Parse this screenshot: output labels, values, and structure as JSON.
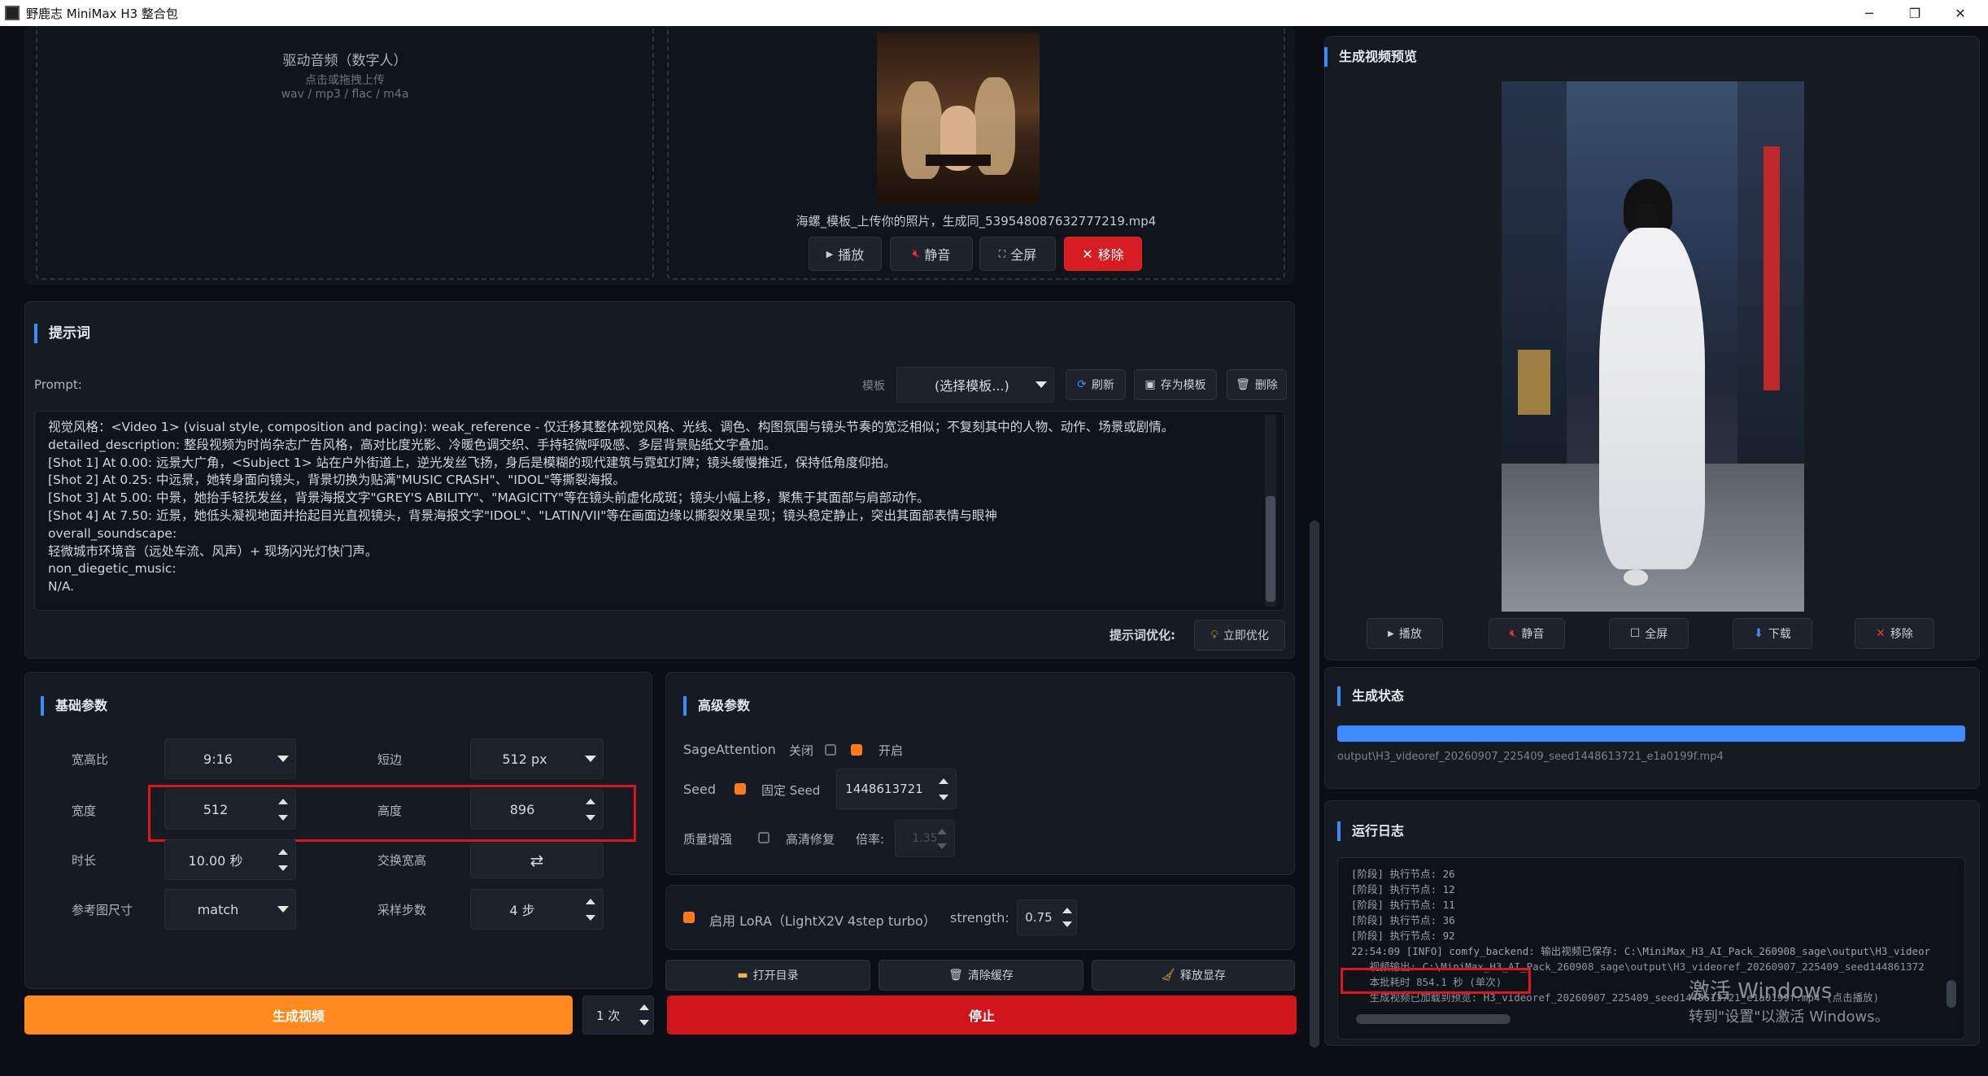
{
  "window": {
    "title": "野鹿志 MiniMax H3 整合包",
    "min": "─",
    "max": "❐",
    "close": "✕"
  },
  "upload": {
    "audio_title": "驱动音频（数字人）",
    "audio_hint": "点击或拖拽上传",
    "audio_formats": "wav / mp3 / flac / m4a",
    "video_filename": "海螺_模板_上传你的照片，生成同_539548087632777219.mp4",
    "play": "播放",
    "mute": "静音",
    "fullscreen": "全屏",
    "remove": "移除"
  },
  "prompt": {
    "section_title": "提示词",
    "label": "Prompt:",
    "template_label": "模板",
    "template_select": "(选择模板...)",
    "refresh": "刷新",
    "save_template": "存为模板",
    "delete": "删除",
    "lines": [
      "视觉风格：<Video 1> (visual style, composition and pacing): weak_reference - 仅迁移其整体视觉风格、光线、调色、构图氛围与镜头节奏的宽泛相似；不复刻其中的人物、动作、场景或剧情。",
      "detailed_description: 整段视频为时尚杂志广告风格，高对比度光影、冷暖色调交织、手持轻微呼吸感、多层背景贴纸文字叠加。",
      "[Shot 1] At 0.00: 远景大广角，<Subject 1> 站在户外街道上，逆光发丝飞扬，身后是模糊的现代建筑与霓虹灯牌；镜头缓慢推近，保持低角度仰拍。",
      "[Shot 2] At 0.25: 中远景，她转身面向镜头，背景切换为贴满\"MUSIC CRASH\"、\"IDOL\"等撕裂海报。",
      "[Shot 3] At 5.00: 中景，她抬手轻抚发丝，背景海报文字\"GREY'S ABILITY\"、\"MAGICITY\"等在镜头前虚化成斑；镜头小幅上移，聚焦于其面部与肩部动作。",
      "[Shot 4] At 7.50: 近景，她低头凝视地面并抬起目光直视镜头，背景海报文字\"IDOL\"、\"LATIN/VII\"等在画面边缘以撕裂效果呈现；镜头稳定静止，突出其面部表情与眼神",
      "overall_soundscape:",
      "轻微城市环境音（远处车流、风声）+ 现场闪光灯快门声。",
      "non_diegetic_music:",
      "N/A."
    ],
    "optimize_label": "提示词优化:",
    "optimize_button": "立即优化"
  },
  "basic": {
    "section_title": "基础参数",
    "aspect_label": "宽高比",
    "aspect_value": "9:16",
    "short_label": "短边",
    "short_value": "512 px",
    "width_label": "宽度",
    "width_value": "512",
    "height_label": "高度",
    "height_value": "896",
    "duration_label": "时长",
    "duration_value": "10.00 秒",
    "swap_label": "交换宽高",
    "swap_icon": "⇄",
    "ref_label": "参考图尺寸",
    "ref_value": "match",
    "steps_label": "采样步数",
    "steps_value": "4 步"
  },
  "advanced": {
    "section_title": "高级参数",
    "sage_label": "SageAttention",
    "sage_off": "关闭",
    "sage_on": "开启",
    "seed_label": "Seed",
    "fixed_seed": "固定 Seed",
    "seed_value": "1448613721",
    "quality_label": "质量增强",
    "hd_label": "高清修复",
    "ratio_label": "倍率:",
    "ratio_value": "1.35",
    "lora_label": "启用 LoRA（LightX2V 4step turbo）",
    "strength_label": "strength:",
    "strength_value": "0.75"
  },
  "actions": {
    "open_dir": "打开目录",
    "clear_cache": "清除缓存",
    "free_vram": "释放显存",
    "generate": "生成视频",
    "count": "1 次",
    "stop": "停止"
  },
  "preview": {
    "section_title": "生成视频预览",
    "play": "播放",
    "mute": "静音",
    "fullscreen": "全屏",
    "download": "下载",
    "remove": "移除"
  },
  "status": {
    "section_title": "生成状态",
    "progress": 1.0,
    "path": "output\\H3_videoref_20260907_225409_seed1448613721_e1a0199f.mp4"
  },
  "log": {
    "section_title": "运行日志",
    "lines": [
      "[阶段] 执行节点: 26",
      "[阶段] 执行节点: 12",
      "[阶段] 执行节点: 11",
      "[阶段] 执行节点: 36",
      "[阶段] 执行节点: 92",
      "22:54:09 [INFO] comfy_backend: 输出视频已保存: C:\\MiniMax_H3_AI_Pack_260908_sage\\output\\H3_videor",
      "   视频输出: C:\\MiniMax_H3_AI_Pack_260908_sage\\output\\H3_videoref_20260907_225409_seed144861372",
      "   本批耗时 854.1 秒 (单次)",
      "   生成视频已加载到预览: H3_videoref_20260907_225409_seed1448613721_e1a0199f.mp4 (点击播放)"
    ]
  },
  "watermark": {
    "line1": "激活 Windows",
    "line2": "转到\"设置\"以激活 Windows。"
  },
  "colors": {
    "accent": "#3d8bff",
    "orange": "#ff8a1f",
    "red": "#d61c22",
    "bg": "#0b0e14",
    "panel": "#161a22"
  }
}
